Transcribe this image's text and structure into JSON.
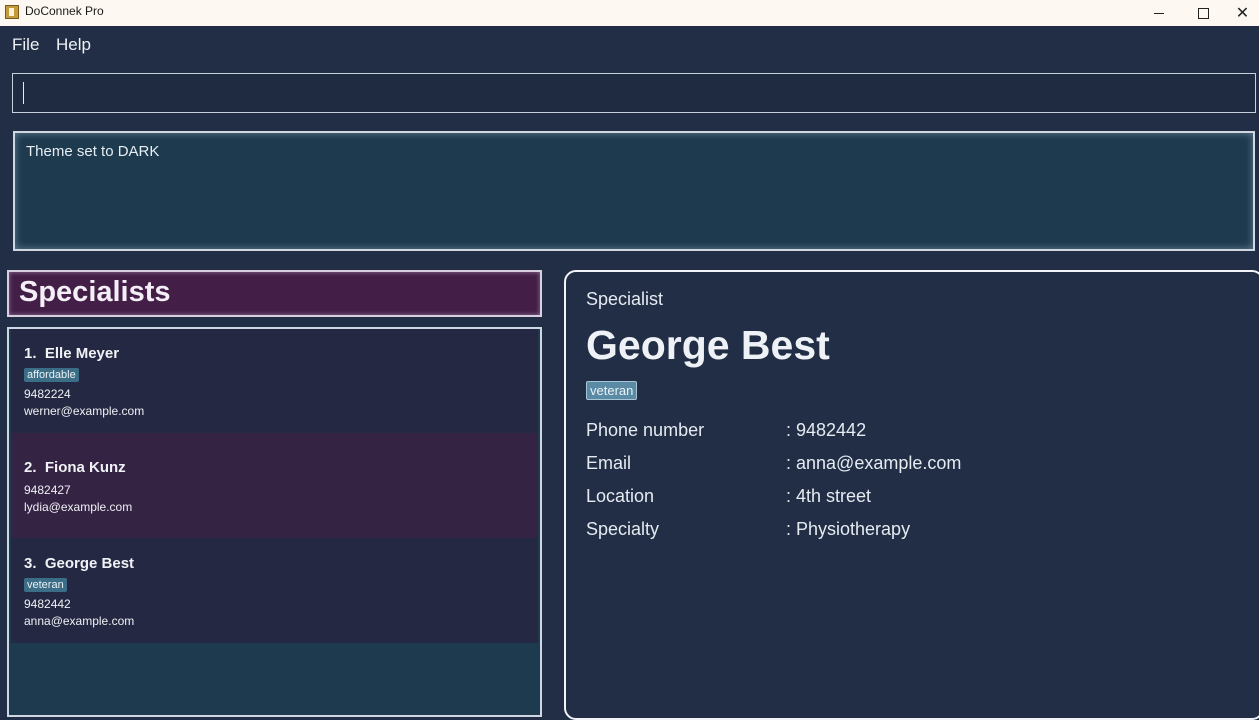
{
  "window": {
    "title": "DoConnek Pro"
  },
  "menu": {
    "file": "File",
    "help": "Help"
  },
  "command_box": {
    "value": ""
  },
  "result": {
    "text": "Theme set to DARK"
  },
  "list": {
    "title": "Specialists",
    "cards": [
      {
        "index": "1.",
        "name": "Elle Meyer",
        "tag": "affordable",
        "phone": "9482224",
        "email": "werner@example.com"
      },
      {
        "index": "2.",
        "name": "Fiona Kunz",
        "phone": "9482427",
        "email": "lydia@example.com"
      },
      {
        "index": "3.",
        "name": "George Best",
        "tag": "veteran",
        "phone": "9482442",
        "email": "anna@example.com"
      }
    ]
  },
  "detail": {
    "kind": "Specialist",
    "name": "George Best",
    "tag": "veteran",
    "fields": [
      {
        "label": "Phone number",
        "value": ": 9482442"
      },
      {
        "label": "Email",
        "value": ": anna@example.com"
      },
      {
        "label": "Location",
        "value": ": 4th street"
      },
      {
        "label": "Specialty",
        "value": ": Physiotherapy"
      }
    ]
  },
  "colors": {
    "background": "#212e45",
    "result_bg": "#1e3a4e",
    "list_header_bg": "#431f48",
    "card_odd_bg": "#252842",
    "card_even_bg": "#352344",
    "tag_bg": "#3c6d86"
  }
}
